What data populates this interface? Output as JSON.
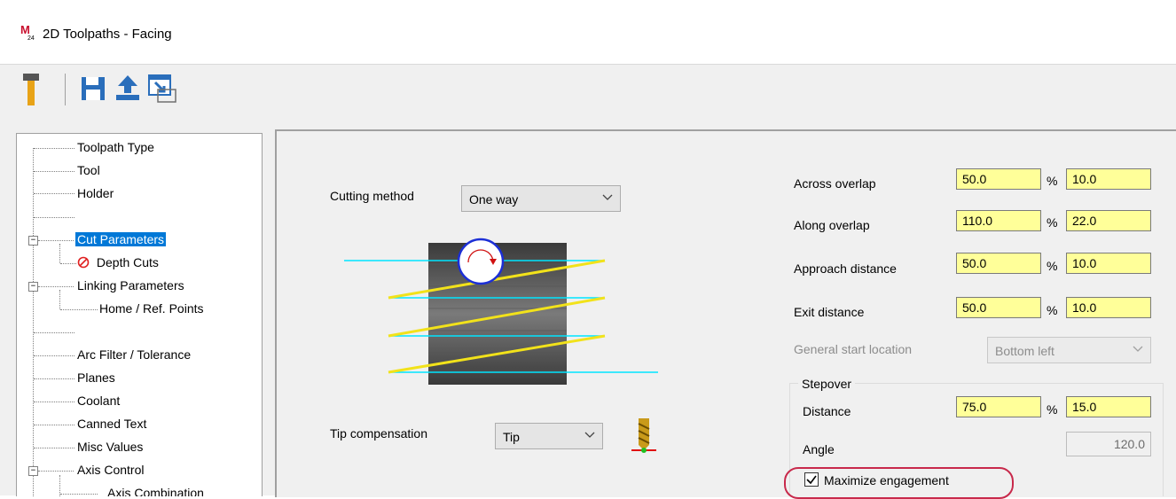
{
  "window": {
    "title": "2D Toolpaths - Facing"
  },
  "toolbar": {
    "buttons": [
      {
        "name": "tool-icon"
      },
      {
        "name": "save-icon"
      },
      {
        "name": "export-icon"
      },
      {
        "name": "import-icon"
      }
    ]
  },
  "tree": {
    "items": [
      {
        "label": "Toolpath Type"
      },
      {
        "label": "Tool"
      },
      {
        "label": "Holder"
      },
      {
        "label": ""
      },
      {
        "label": "Cut Parameters"
      },
      {
        "label": "Depth Cuts"
      },
      {
        "label": "Linking Parameters"
      },
      {
        "label": "Home / Ref. Points"
      },
      {
        "label": ""
      },
      {
        "label": "Arc Filter / Tolerance"
      },
      {
        "label": "Planes"
      },
      {
        "label": "Coolant"
      },
      {
        "label": "Canned Text"
      },
      {
        "label": "Misc Values"
      },
      {
        "label": "Axis Control"
      },
      {
        "label": "Axis Combination"
      }
    ]
  },
  "params": {
    "cutting_method": {
      "label": "Cutting method",
      "value": "One way"
    },
    "tip_compensation": {
      "label": "Tip compensation",
      "value": "Tip"
    },
    "across_overlap": {
      "label": "Across overlap",
      "percent": "50.0",
      "value": "10.0"
    },
    "along_overlap": {
      "label": "Along overlap",
      "percent": "110.0",
      "value": "22.0"
    },
    "approach_distance": {
      "label": "Approach distance",
      "percent": "50.0",
      "value": "10.0"
    },
    "exit_distance": {
      "label": "Exit distance",
      "percent": "50.0",
      "value": "10.0"
    },
    "general_start_location": {
      "label": "General start location",
      "value": "Bottom left"
    },
    "percent_sign": "%",
    "stepover": {
      "title": "Stepover",
      "distance_label": "Distance",
      "distance_percent": "75.0",
      "distance_value": "15.0",
      "angle_label": "Angle",
      "angle_value": "120.0"
    },
    "maximize_engagement": {
      "label": "Maximize engagement",
      "checked": true
    }
  },
  "colors": {
    "field_bg": "#ffff99",
    "selection": "#0078d7",
    "highlight_ring": "#c8294b",
    "path_cyan": "#00e5ff",
    "path_yellow": "#f2e21a"
  }
}
